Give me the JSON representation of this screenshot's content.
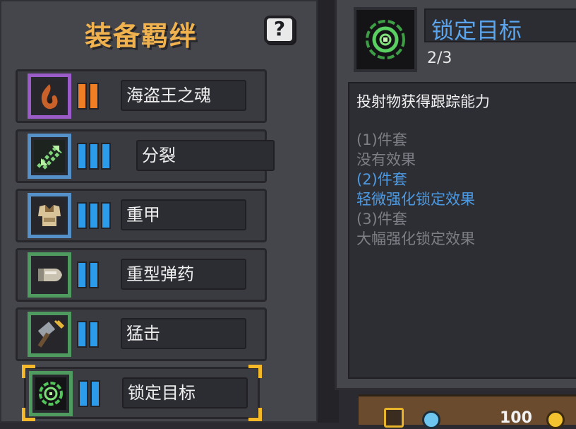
{
  "panel_title": "装备羁绊",
  "help_label": "?",
  "sets": [
    {
      "name": "海盗王之魂",
      "icon": "flame-soul-icon",
      "frame_color": "#9b5cc9",
      "pip_color": "#f07e25",
      "tier": 2,
      "max_tier": 2
    },
    {
      "name": "分裂",
      "icon": "split-arrows-icon",
      "frame_color": "#5591c8",
      "pip_color": "#2c9bea",
      "tier": 3,
      "max_tier": 3
    },
    {
      "name": "重甲",
      "icon": "heavy-armor-icon",
      "frame_color": "#5591c8",
      "pip_color": "#2c9bea",
      "tier": 3,
      "max_tier": 3
    },
    {
      "name": "重型弹药",
      "icon": "bullet-icon",
      "frame_color": "#4f9a5e",
      "pip_color": "#2c9bea",
      "tier": 2,
      "max_tier": 2
    },
    {
      "name": "猛击",
      "icon": "hammer-icon",
      "frame_color": "#4f9a5e",
      "pip_color": "#2c9bea",
      "tier": 2,
      "max_tier": 2
    },
    {
      "name": "锁定目标",
      "icon": "crosshair-target-icon",
      "frame_color": "#4f9a5e",
      "pip_color": "#2c9bea",
      "tier": 2,
      "max_tier": 2,
      "selected": true
    }
  ],
  "detail": {
    "name": "锁定目标",
    "progress": "2/3",
    "icon": "crosshair-target-icon",
    "description": "投射物获得跟踪能力",
    "tiers": [
      {
        "label": "(1)件套",
        "effect": "没有效果",
        "active": false
      },
      {
        "label": "(2)件套",
        "effect": "轻微强化锁定效果",
        "active": true
      },
      {
        "label": "(3)件套",
        "effect": "大幅强化锁定效果",
        "active": false
      }
    ]
  },
  "hud": {
    "value": "100"
  },
  "colors": {
    "title": "#f0b24e",
    "active_tier": "#4d9ae3",
    "inactive_tier": "#7e7f86",
    "selection_corner": "#f4b828"
  }
}
